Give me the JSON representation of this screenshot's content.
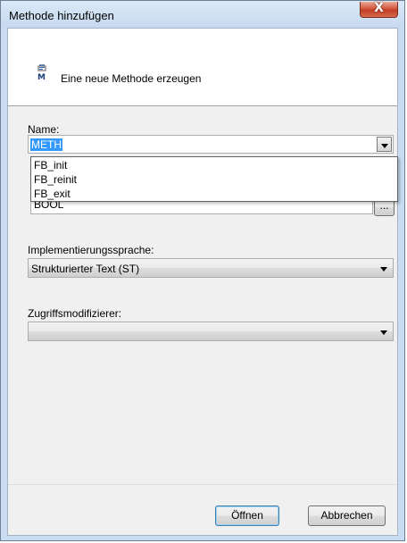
{
  "window": {
    "title": "Methode hinzufügen",
    "close_label": "X"
  },
  "header": {
    "icon": "method-icon",
    "icon_letter": "M",
    "text": "Eine neue Methode erzeugen"
  },
  "name": {
    "label": "Name:",
    "value": "METH",
    "options": [
      "FB_init",
      "FB_reinit",
      "FB_exit"
    ]
  },
  "return_type": {
    "value": "BOOL",
    "browse_label": "..."
  },
  "implementation": {
    "label": "Implementierungssprache:",
    "value": "Strukturierter Text (ST)"
  },
  "access": {
    "label": "Zugriffsmodifizierer:",
    "value": ""
  },
  "buttons": {
    "open": "Öffnen",
    "cancel": "Abbrechen"
  }
}
